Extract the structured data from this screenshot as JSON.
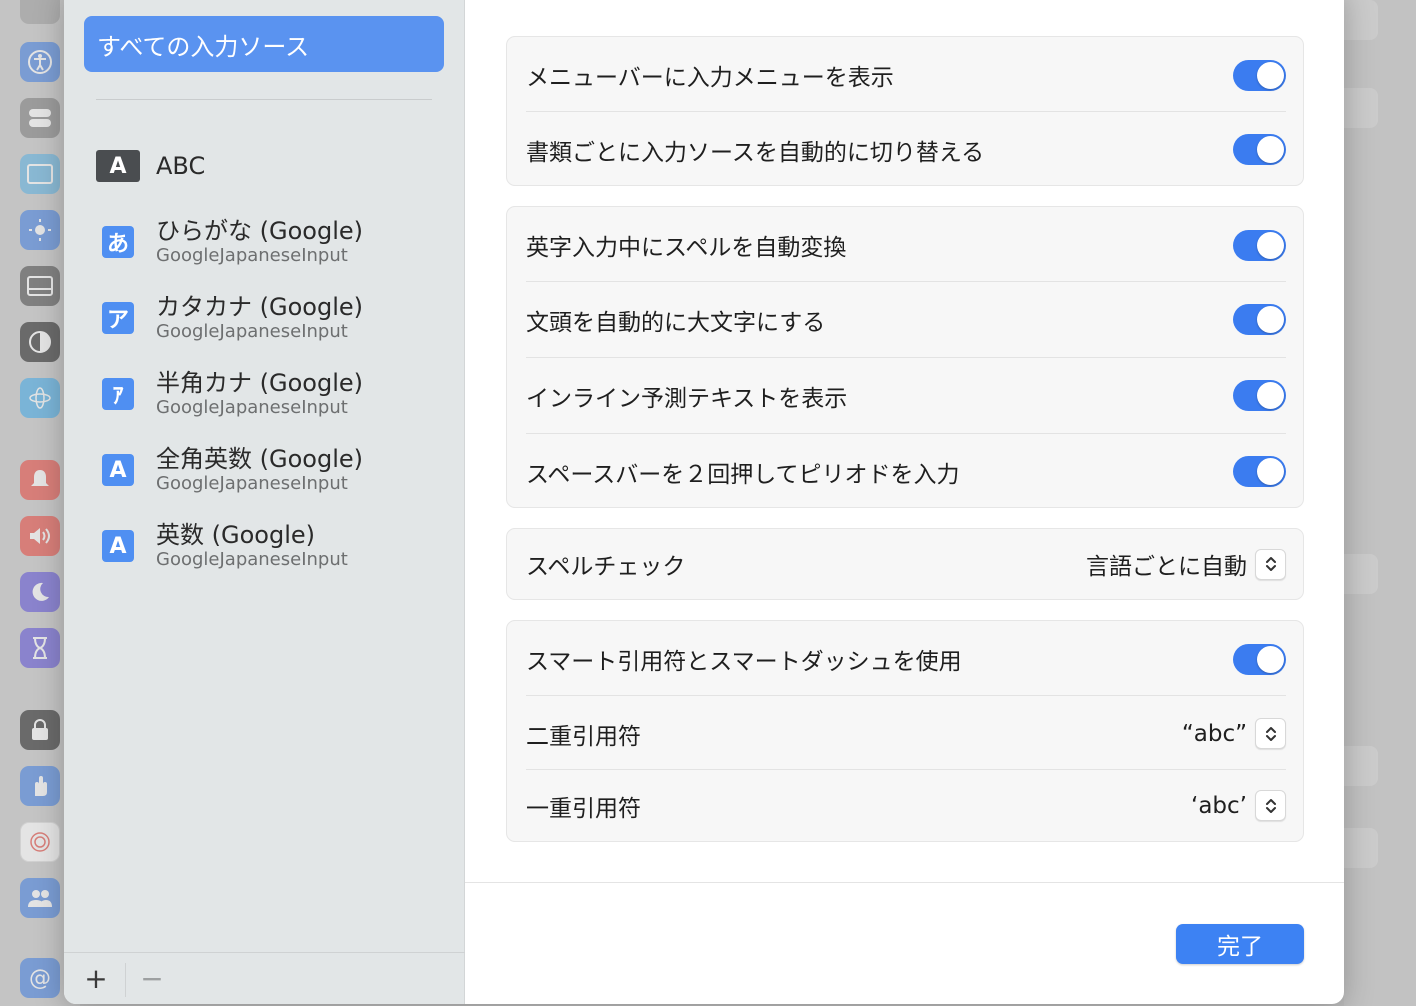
{
  "background": {
    "sidebar_icons": [
      {
        "icon": "search-icon",
        "color": "#9a9a9a"
      },
      {
        "icon": "accessibility-icon",
        "color": "#3f7de0"
      },
      {
        "icon": "control-center-icon",
        "color": "#7a7a7a"
      },
      {
        "icon": "desktop-icon",
        "color": "#5ab0e0"
      },
      {
        "icon": "display-brightness-icon",
        "color": "#3f7de0"
      },
      {
        "icon": "wallpaper-icon",
        "color": "#4a4a4a"
      },
      {
        "icon": "screensaver-icon",
        "color": "#222222"
      },
      {
        "icon": "siri-icon",
        "color": "#3fa8e8"
      },
      {
        "icon": "notifications-icon",
        "color": "#e8453c"
      },
      {
        "icon": "sound-icon",
        "color": "#e8453c"
      },
      {
        "icon": "focus-icon",
        "color": "#5b4ed6"
      },
      {
        "icon": "screen-time-icon",
        "color": "#5b4ed6"
      },
      {
        "icon": "lock-screen-icon",
        "color": "#222222"
      },
      {
        "icon": "privacy-icon",
        "color": "#3f7de0"
      },
      {
        "icon": "touch-id-icon",
        "color": "#ffffff"
      },
      {
        "icon": "users-icon",
        "color": "#3f7de0"
      },
      {
        "icon": "internet-accounts-icon",
        "color": "#3f7de0"
      }
    ]
  },
  "sources": {
    "all_label": "すべての入力ソース",
    "items": [
      {
        "icon_glyph": "A",
        "name": "ABC",
        "sub": ""
      },
      {
        "icon_glyph": "あ",
        "name": "ひらがな (Google)",
        "sub": "GoogleJapaneseInput"
      },
      {
        "icon_glyph": "ア",
        "name": "カタカナ (Google)",
        "sub": "GoogleJapaneseInput"
      },
      {
        "icon_glyph": "ｱ",
        "name": "半角カナ (Google)",
        "sub": "GoogleJapaneseInput"
      },
      {
        "icon_glyph": "A",
        "name": "全角英数 (Google)",
        "sub": "GoogleJapaneseInput"
      },
      {
        "icon_glyph": "A",
        "name": "英数 (Google)",
        "sub": "GoogleJapaneseInput"
      }
    ],
    "add_label": "+",
    "remove_label": "−"
  },
  "settings": {
    "show_input_menu": {
      "label": "メニューバーに入力メニューを表示",
      "on": true
    },
    "auto_switch": {
      "label": "書類ごとに入力ソースを自動的に切り替える",
      "on": true
    },
    "auto_correct": {
      "label": "英字入力中にスペルを自動変換",
      "on": true
    },
    "auto_capitalize": {
      "label": "文頭を自動的に大文字にする",
      "on": true
    },
    "inline_predictive": {
      "label": "インライン予測テキストを表示",
      "on": true
    },
    "double_space_period": {
      "label": "スペースバーを２回押してピリオドを入力",
      "on": true
    },
    "spell_check": {
      "label": "スペルチェック",
      "value": "言語ごとに自動"
    },
    "smart_quotes": {
      "label": "スマート引用符とスマートダッシュを使用",
      "on": true
    },
    "double_quotes": {
      "label": "二重引用符",
      "value": "“abc”"
    },
    "single_quotes": {
      "label": "一重引用符",
      "value": "‘abc’"
    }
  },
  "footer": {
    "done_label": "完了"
  },
  "colors": {
    "accent": "#3b7cf0",
    "selection": "#5a93f0"
  }
}
